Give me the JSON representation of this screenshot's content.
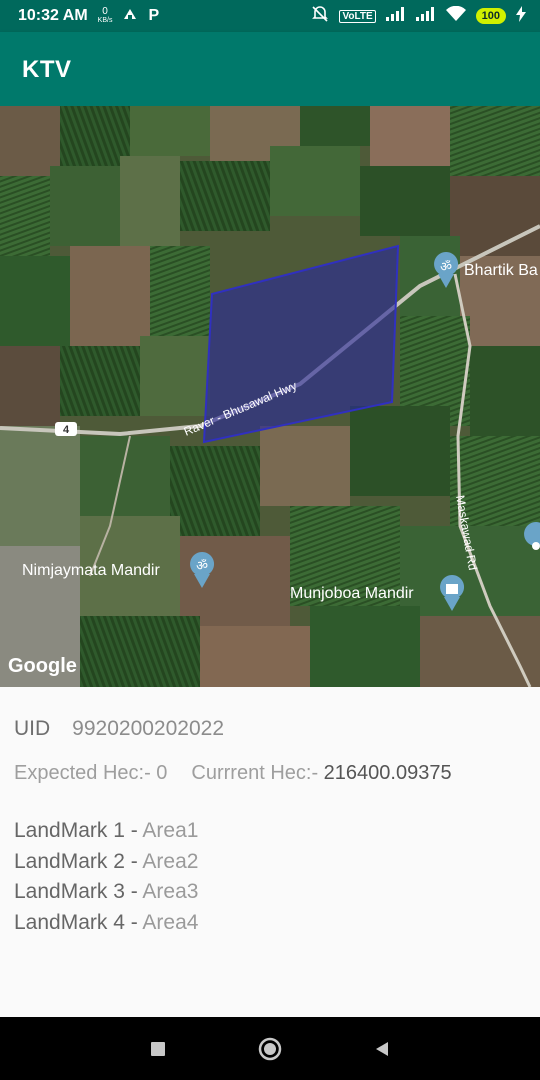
{
  "status_bar": {
    "time": "10:32 AM",
    "net_speed_value": "0",
    "net_speed_unit": "KB/s",
    "p_icon_label": "P",
    "volte_label": "VoLTE",
    "battery": "100",
    "icons": [
      "data-speed",
      "recycle-icon",
      "parking-icon",
      "mute-icon",
      "volte-icon",
      "signal-icon",
      "signal-icon",
      "wifi-icon",
      "battery-icon",
      "charging-icon"
    ]
  },
  "app_bar": {
    "title": "KTV"
  },
  "map": {
    "google_logo": "Google",
    "labels": {
      "bhartik": "Bhartik Ba",
      "road": "Raver - Bhusawal Hwy",
      "maskawad": "Maskawad Rd",
      "nimjaymata": "Nimjaymata Mandir",
      "munjoboa": "Munjoboa Mandir",
      "route_number": "4"
    },
    "polygon_color": "#2a2a9a"
  },
  "details": {
    "uid_label": "UID",
    "uid_value": "9920200202022",
    "expected_label": "Expected Hec:- ",
    "expected_value": "0",
    "current_label": "Currrent Hec:- ",
    "current_value": "216400.09375",
    "landmarks": [
      {
        "label": "LandMark 1 - ",
        "area": "Area1"
      },
      {
        "label": "LandMark 2 - ",
        "area": "Area2"
      },
      {
        "label": "LandMark 3 - ",
        "area": "Area3"
      },
      {
        "label": "LandMark 4 - ",
        "area": "Area4"
      }
    ]
  },
  "nav_bar": {
    "buttons": [
      "recents",
      "home",
      "back"
    ]
  },
  "colors": {
    "status_bar": "#00695c",
    "app_bar": "#00796b",
    "background": "#fafafa"
  }
}
